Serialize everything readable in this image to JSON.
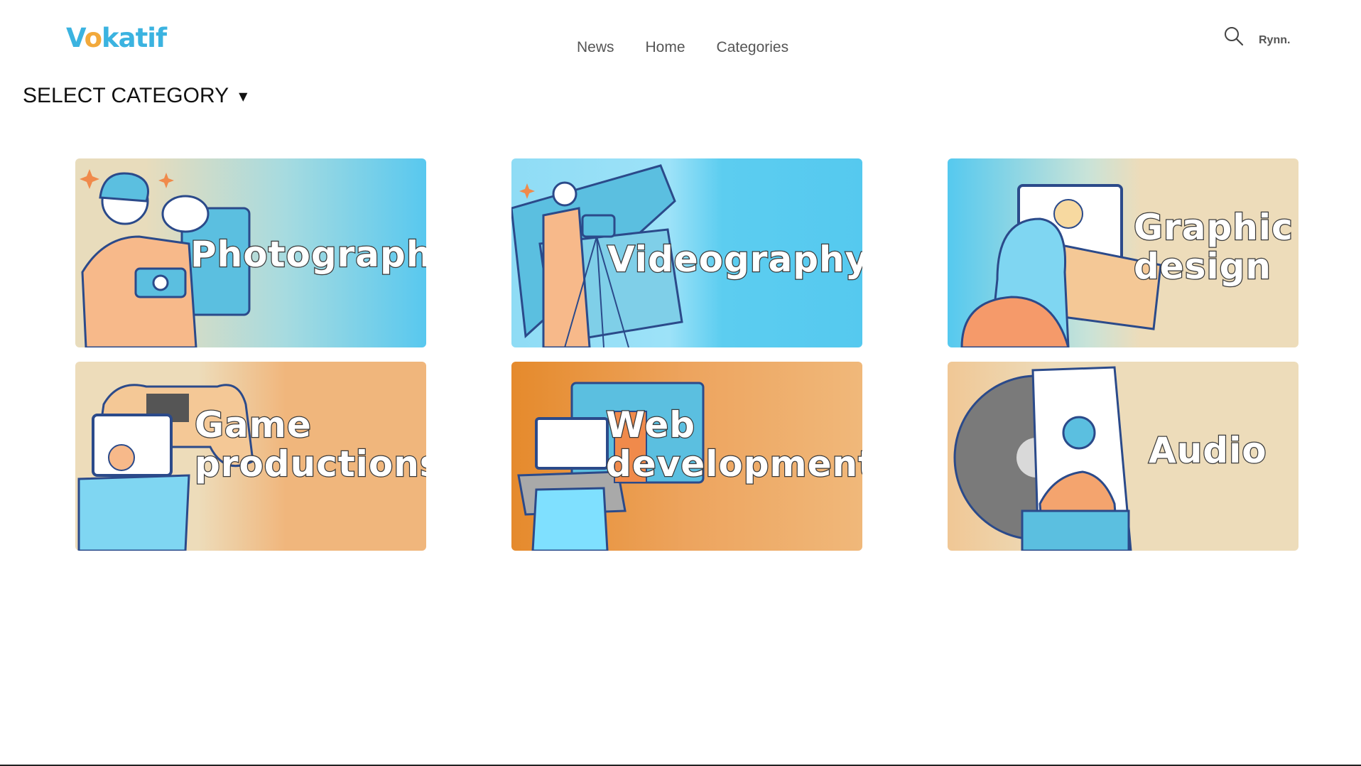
{
  "brand": {
    "logo_part1": "V",
    "logo_o": "o",
    "logo_part2": "katif"
  },
  "nav": {
    "items": [
      "News",
      "Home",
      "Categories"
    ]
  },
  "header": {
    "user_name": "Rynn."
  },
  "filter": {
    "label": "SELECT CATEGORY",
    "caret": "▼"
  },
  "categories": [
    {
      "title_line1": "Photograph",
      "title_line2": ""
    },
    {
      "title_line1": "Videography",
      "title_line2": ""
    },
    {
      "title_line1": "Graphic",
      "title_line2": "design"
    },
    {
      "title_line1": "Game",
      "title_line2": "productions"
    },
    {
      "title_line1": "Web",
      "title_line2": "development"
    },
    {
      "title_line1": "Audio",
      "title_line2": ""
    }
  ],
  "colors": {
    "brand_blue": "#3bb3e0",
    "brand_orange": "#f2a93b",
    "card_blue": "#5ccdf0",
    "card_beige": "#eddcba",
    "card_orange": "#e89a3c"
  }
}
